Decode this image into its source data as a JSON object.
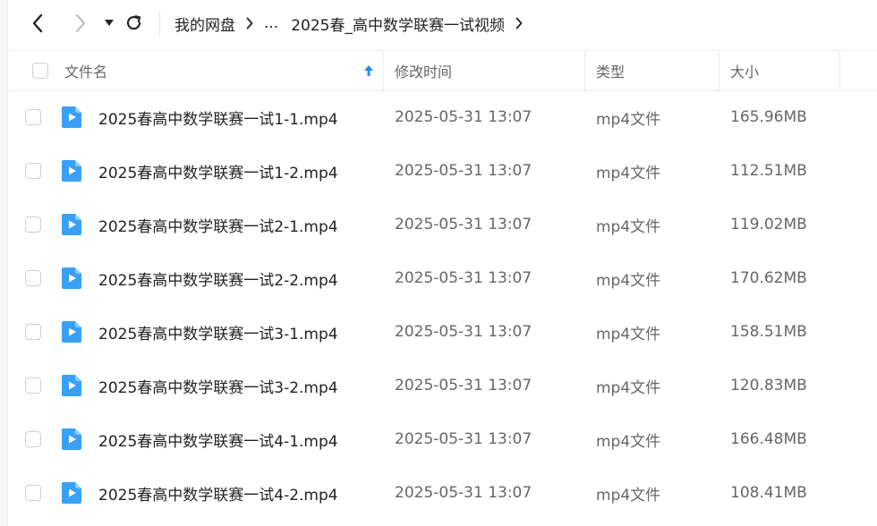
{
  "breadcrumb": {
    "root": "我的网盘",
    "ellipsis": "...",
    "current": "2025春_高中数学联赛一试视频"
  },
  "columns": {
    "name": "文件名",
    "modified": "修改时间",
    "type": "类型",
    "size": "大小",
    "sort_indicator": "arrow-up-icon"
  },
  "files": [
    {
      "name": "2025春高中数学联赛一试1-1.mp4",
      "modified": "2025-05-31 13:07",
      "type": "mp4文件",
      "size": "165.96MB"
    },
    {
      "name": "2025春高中数学联赛一试1-2.mp4",
      "modified": "2025-05-31 13:07",
      "type": "mp4文件",
      "size": "112.51MB"
    },
    {
      "name": "2025春高中数学联赛一试2-1.mp4",
      "modified": "2025-05-31 13:07",
      "type": "mp4文件",
      "size": "119.02MB"
    },
    {
      "name": "2025春高中数学联赛一试2-2.mp4",
      "modified": "2025-05-31 13:07",
      "type": "mp4文件",
      "size": "170.62MB"
    },
    {
      "name": "2025春高中数学联赛一试3-1.mp4",
      "modified": "2025-05-31 13:07",
      "type": "mp4文件",
      "size": "158.51MB"
    },
    {
      "name": "2025春高中数学联赛一试3-2.mp4",
      "modified": "2025-05-31 13:07",
      "type": "mp4文件",
      "size": "120.83MB"
    },
    {
      "name": "2025春高中数学联赛一试4-1.mp4",
      "modified": "2025-05-31 13:07",
      "type": "mp4文件",
      "size": "166.48MB"
    },
    {
      "name": "2025春高中数学联赛一试4-2.mp4",
      "modified": "2025-05-31 13:07",
      "type": "mp4文件",
      "size": "108.41MB"
    }
  ],
  "colors": {
    "accent": "#1f8ff0",
    "file_icon": "#3aa0f5",
    "file_icon_fold": "#8ec9fa"
  }
}
